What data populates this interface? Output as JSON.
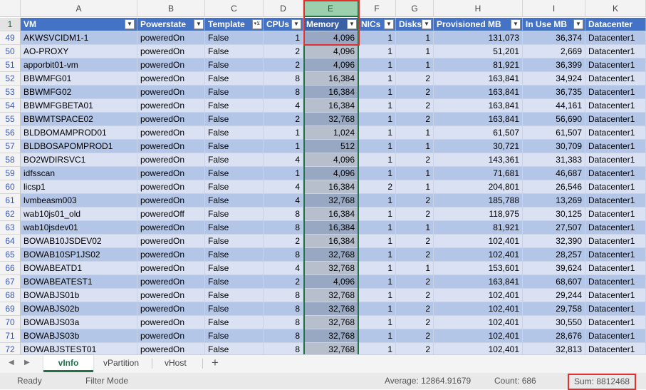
{
  "columns": [
    "A",
    "B",
    "C",
    "D",
    "E",
    "F",
    "G",
    "H",
    "I",
    "K"
  ],
  "selected_column": "E",
  "header_row_number": "1",
  "headers": [
    "VM",
    "Powerstate",
    "Template",
    "CPUs",
    "Memory",
    "NICs",
    "Disks",
    "Provisioned MB",
    "In Use MB",
    "Datacenter"
  ],
  "rows": [
    {
      "n": "49",
      "vm": "AKWSVCIDM1-1",
      "power": "poweredOn",
      "tpl": "False",
      "cpus": "1",
      "mem": "4,096",
      "nics": "1",
      "disks": "1",
      "prov": "131,073",
      "inuse": "36,374",
      "dc": "Datacenter1"
    },
    {
      "n": "50",
      "vm": "AO-PROXY",
      "power": "poweredOn",
      "tpl": "False",
      "cpus": "2",
      "mem": "4,096",
      "nics": "1",
      "disks": "1",
      "prov": "51,201",
      "inuse": "2,669",
      "dc": "Datacenter1"
    },
    {
      "n": "51",
      "vm": "apporbit01-vm",
      "power": "poweredOn",
      "tpl": "False",
      "cpus": "2",
      "mem": "4,096",
      "nics": "1",
      "disks": "1",
      "prov": "81,921",
      "inuse": "36,399",
      "dc": "Datacenter1"
    },
    {
      "n": "52",
      "vm": "BBWMFG01",
      "power": "poweredOn",
      "tpl": "False",
      "cpus": "8",
      "mem": "16,384",
      "nics": "1",
      "disks": "2",
      "prov": "163,841",
      "inuse": "34,924",
      "dc": "Datacenter1"
    },
    {
      "n": "53",
      "vm": "BBWMFG02",
      "power": "poweredOn",
      "tpl": "False",
      "cpus": "8",
      "mem": "16,384",
      "nics": "1",
      "disks": "2",
      "prov": "163,841",
      "inuse": "36,735",
      "dc": "Datacenter1"
    },
    {
      "n": "54",
      "vm": "BBWMFGBETA01",
      "power": "poweredOn",
      "tpl": "False",
      "cpus": "4",
      "mem": "16,384",
      "nics": "1",
      "disks": "2",
      "prov": "163,841",
      "inuse": "44,161",
      "dc": "Datacenter1"
    },
    {
      "n": "55",
      "vm": "BBWMTSPACE02",
      "power": "poweredOn",
      "tpl": "False",
      "cpus": "2",
      "mem": "32,768",
      "nics": "1",
      "disks": "2",
      "prov": "163,841",
      "inuse": "56,690",
      "dc": "Datacenter1"
    },
    {
      "n": "56",
      "vm": "BLDBOMAMPROD01",
      "power": "poweredOn",
      "tpl": "False",
      "cpus": "1",
      "mem": "1,024",
      "nics": "1",
      "disks": "1",
      "prov": "61,507",
      "inuse": "61,507",
      "dc": "Datacenter1"
    },
    {
      "n": "57",
      "vm": "BLDBOSAPOMPROD1",
      "power": "poweredOn",
      "tpl": "False",
      "cpus": "1",
      "mem": "512",
      "nics": "1",
      "disks": "1",
      "prov": "30,721",
      "inuse": "30,709",
      "dc": "Datacenter1"
    },
    {
      "n": "58",
      "vm": "BO2WDIRSVC1",
      "power": "poweredOn",
      "tpl": "False",
      "cpus": "4",
      "mem": "4,096",
      "nics": "1",
      "disks": "2",
      "prov": "143,361",
      "inuse": "31,383",
      "dc": "Datacenter1"
    },
    {
      "n": "59",
      "vm": "idfsscan",
      "power": "poweredOn",
      "tpl": "False",
      "cpus": "1",
      "mem": "4,096",
      "nics": "1",
      "disks": "1",
      "prov": "71,681",
      "inuse": "46,687",
      "dc": "Datacenter1"
    },
    {
      "n": "60",
      "vm": "licsp1",
      "power": "poweredOn",
      "tpl": "False",
      "cpus": "4",
      "mem": "16,384",
      "nics": "2",
      "disks": "1",
      "prov": "204,801",
      "inuse": "26,546",
      "dc": "Datacenter1"
    },
    {
      "n": "61",
      "vm": "lvmbeasm003",
      "power": "poweredOn",
      "tpl": "False",
      "cpus": "4",
      "mem": "32,768",
      "nics": "1",
      "disks": "2",
      "prov": "185,788",
      "inuse": "13,269",
      "dc": "Datacenter1"
    },
    {
      "n": "62",
      "vm": "wab10js01_old",
      "power": "poweredOff",
      "tpl": "False",
      "cpus": "8",
      "mem": "16,384",
      "nics": "1",
      "disks": "2",
      "prov": "118,975",
      "inuse": "30,125",
      "dc": "Datacenter1"
    },
    {
      "n": "63",
      "vm": "wab10jsdev01",
      "power": "poweredOn",
      "tpl": "False",
      "cpus": "8",
      "mem": "16,384",
      "nics": "1",
      "disks": "1",
      "prov": "81,921",
      "inuse": "27,507",
      "dc": "Datacenter1"
    },
    {
      "n": "64",
      "vm": "BOWAB10JSDEV02",
      "power": "poweredOn",
      "tpl": "False",
      "cpus": "2",
      "mem": "16,384",
      "nics": "1",
      "disks": "2",
      "prov": "102,401",
      "inuse": "32,390",
      "dc": "Datacenter1"
    },
    {
      "n": "65",
      "vm": "BOWAB10SP1JS02",
      "power": "poweredOn",
      "tpl": "False",
      "cpus": "8",
      "mem": "32,768",
      "nics": "1",
      "disks": "2",
      "prov": "102,401",
      "inuse": "28,257",
      "dc": "Datacenter1"
    },
    {
      "n": "66",
      "vm": "BOWABEATD1",
      "power": "poweredOn",
      "tpl": "False",
      "cpus": "4",
      "mem": "32,768",
      "nics": "1",
      "disks": "1",
      "prov": "153,601",
      "inuse": "39,624",
      "dc": "Datacenter1"
    },
    {
      "n": "67",
      "vm": "BOWABEATEST1",
      "power": "poweredOn",
      "tpl": "False",
      "cpus": "2",
      "mem": "4,096",
      "nics": "1",
      "disks": "2",
      "prov": "163,841",
      "inuse": "68,607",
      "dc": "Datacenter1"
    },
    {
      "n": "68",
      "vm": "BOWABJS01b",
      "power": "poweredOn",
      "tpl": "False",
      "cpus": "8",
      "mem": "32,768",
      "nics": "1",
      "disks": "2",
      "prov": "102,401",
      "inuse": "29,244",
      "dc": "Datacenter1"
    },
    {
      "n": "69",
      "vm": "BOWABJS02b",
      "power": "poweredOn",
      "tpl": "False",
      "cpus": "8",
      "mem": "32,768",
      "nics": "1",
      "disks": "2",
      "prov": "102,401",
      "inuse": "29,758",
      "dc": "Datacenter1"
    },
    {
      "n": "70",
      "vm": "BOWABJS03a",
      "power": "poweredOn",
      "tpl": "False",
      "cpus": "8",
      "mem": "32,768",
      "nics": "1",
      "disks": "2",
      "prov": "102,401",
      "inuse": "30,550",
      "dc": "Datacenter1"
    },
    {
      "n": "71",
      "vm": "BOWABJS03b",
      "power": "poweredOn",
      "tpl": "False",
      "cpus": "8",
      "mem": "32,768",
      "nics": "1",
      "disks": "2",
      "prov": "102,401",
      "inuse": "28,676",
      "dc": "Datacenter1"
    },
    {
      "n": "72",
      "vm": "BOWABJSTEST01",
      "power": "poweredOn",
      "tpl": "False",
      "cpus": "8",
      "mem": "32,768",
      "nics": "1",
      "disks": "2",
      "prov": "102,401",
      "inuse": "32,813",
      "dc": "Datacenter1"
    }
  ],
  "sheet_tabs": [
    "vInfo",
    "vPartition",
    "vHost"
  ],
  "active_tab": "vInfo",
  "add_sheet_label": "+",
  "status": {
    "ready": "Ready",
    "mode": "Filter Mode",
    "average": "Average: 12864.91679",
    "count": "Count: 686",
    "sum": "Sum: 8812468"
  },
  "colors": {
    "header_blue": "#4472c4",
    "band_dark": "#b4c6e7",
    "band_light": "#d9e1f2",
    "excel_green": "#217346",
    "highlight_red": "#e0312f"
  },
  "icons": {
    "filter": "filter-dropdown-icon",
    "filter_active": "filter-active-icon",
    "scroll_left": "scroll-left-icon",
    "scroll_right": "scroll-right-icon"
  }
}
